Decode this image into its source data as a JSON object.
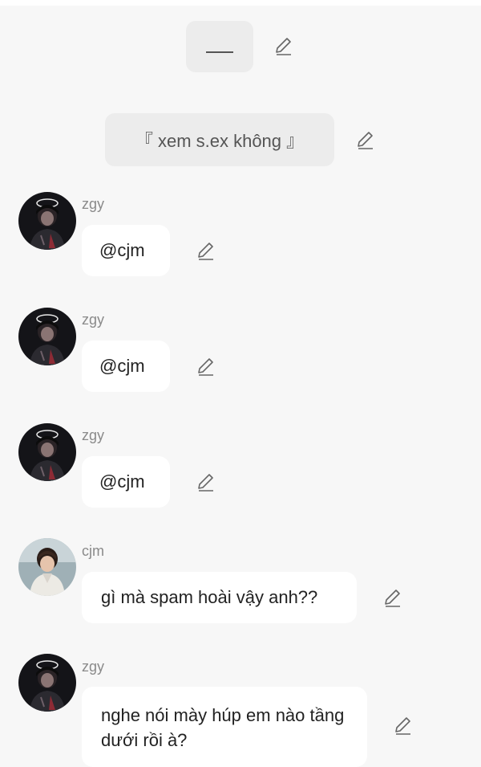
{
  "system_messages": [
    {
      "text": "___"
    },
    {
      "text": "『 xem s.ex không 』"
    }
  ],
  "messages": [
    {
      "sender": "zgy",
      "text": "@cjm",
      "avatar": "zgy-avatar"
    },
    {
      "sender": "zgy",
      "text": "@cjm",
      "avatar": "zgy-avatar"
    },
    {
      "sender": "zgy",
      "text": "@cjm",
      "avatar": "zgy-avatar"
    },
    {
      "sender": "cjm",
      "text": "gì mà spam hoài vậy anh??",
      "avatar": "cjm-avatar"
    },
    {
      "sender": "zgy",
      "text": "nghe nói mày húp em nào tầng dưới rồi à?",
      "avatar": "zgy-avatar"
    }
  ],
  "icons": {
    "edit": "pencil-edit-icon"
  },
  "colors": {
    "background": "#f7f7f7",
    "system_bubble": "#ececec",
    "message_bubble": "#ffffff",
    "sender_name": "#8a8a8a"
  }
}
